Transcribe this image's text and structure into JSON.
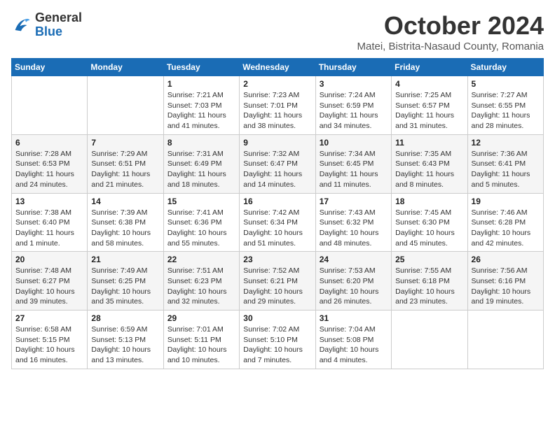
{
  "logo": {
    "general": "General",
    "blue": "Blue"
  },
  "title": "October 2024",
  "subtitle": "Matei, Bistrita-Nasaud County, Romania",
  "days": [
    "Sunday",
    "Monday",
    "Tuesday",
    "Wednesday",
    "Thursday",
    "Friday",
    "Saturday"
  ],
  "weeks": [
    [
      {
        "day": "",
        "info": ""
      },
      {
        "day": "",
        "info": ""
      },
      {
        "day": "1",
        "info": "Sunrise: 7:21 AM\nSunset: 7:03 PM\nDaylight: 11 hours and 41 minutes."
      },
      {
        "day": "2",
        "info": "Sunrise: 7:23 AM\nSunset: 7:01 PM\nDaylight: 11 hours and 38 minutes."
      },
      {
        "day": "3",
        "info": "Sunrise: 7:24 AM\nSunset: 6:59 PM\nDaylight: 11 hours and 34 minutes."
      },
      {
        "day": "4",
        "info": "Sunrise: 7:25 AM\nSunset: 6:57 PM\nDaylight: 11 hours and 31 minutes."
      },
      {
        "day": "5",
        "info": "Sunrise: 7:27 AM\nSunset: 6:55 PM\nDaylight: 11 hours and 28 minutes."
      }
    ],
    [
      {
        "day": "6",
        "info": "Sunrise: 7:28 AM\nSunset: 6:53 PM\nDaylight: 11 hours and 24 minutes."
      },
      {
        "day": "7",
        "info": "Sunrise: 7:29 AM\nSunset: 6:51 PM\nDaylight: 11 hours and 21 minutes."
      },
      {
        "day": "8",
        "info": "Sunrise: 7:31 AM\nSunset: 6:49 PM\nDaylight: 11 hours and 18 minutes."
      },
      {
        "day": "9",
        "info": "Sunrise: 7:32 AM\nSunset: 6:47 PM\nDaylight: 11 hours and 14 minutes."
      },
      {
        "day": "10",
        "info": "Sunrise: 7:34 AM\nSunset: 6:45 PM\nDaylight: 11 hours and 11 minutes."
      },
      {
        "day": "11",
        "info": "Sunrise: 7:35 AM\nSunset: 6:43 PM\nDaylight: 11 hours and 8 minutes."
      },
      {
        "day": "12",
        "info": "Sunrise: 7:36 AM\nSunset: 6:41 PM\nDaylight: 11 hours and 5 minutes."
      }
    ],
    [
      {
        "day": "13",
        "info": "Sunrise: 7:38 AM\nSunset: 6:40 PM\nDaylight: 11 hours and 1 minute."
      },
      {
        "day": "14",
        "info": "Sunrise: 7:39 AM\nSunset: 6:38 PM\nDaylight: 10 hours and 58 minutes."
      },
      {
        "day": "15",
        "info": "Sunrise: 7:41 AM\nSunset: 6:36 PM\nDaylight: 10 hours and 55 minutes."
      },
      {
        "day": "16",
        "info": "Sunrise: 7:42 AM\nSunset: 6:34 PM\nDaylight: 10 hours and 51 minutes."
      },
      {
        "day": "17",
        "info": "Sunrise: 7:43 AM\nSunset: 6:32 PM\nDaylight: 10 hours and 48 minutes."
      },
      {
        "day": "18",
        "info": "Sunrise: 7:45 AM\nSunset: 6:30 PM\nDaylight: 10 hours and 45 minutes."
      },
      {
        "day": "19",
        "info": "Sunrise: 7:46 AM\nSunset: 6:28 PM\nDaylight: 10 hours and 42 minutes."
      }
    ],
    [
      {
        "day": "20",
        "info": "Sunrise: 7:48 AM\nSunset: 6:27 PM\nDaylight: 10 hours and 39 minutes."
      },
      {
        "day": "21",
        "info": "Sunrise: 7:49 AM\nSunset: 6:25 PM\nDaylight: 10 hours and 35 minutes."
      },
      {
        "day": "22",
        "info": "Sunrise: 7:51 AM\nSunset: 6:23 PM\nDaylight: 10 hours and 32 minutes."
      },
      {
        "day": "23",
        "info": "Sunrise: 7:52 AM\nSunset: 6:21 PM\nDaylight: 10 hours and 29 minutes."
      },
      {
        "day": "24",
        "info": "Sunrise: 7:53 AM\nSunset: 6:20 PM\nDaylight: 10 hours and 26 minutes."
      },
      {
        "day": "25",
        "info": "Sunrise: 7:55 AM\nSunset: 6:18 PM\nDaylight: 10 hours and 23 minutes."
      },
      {
        "day": "26",
        "info": "Sunrise: 7:56 AM\nSunset: 6:16 PM\nDaylight: 10 hours and 19 minutes."
      }
    ],
    [
      {
        "day": "27",
        "info": "Sunrise: 6:58 AM\nSunset: 5:15 PM\nDaylight: 10 hours and 16 minutes."
      },
      {
        "day": "28",
        "info": "Sunrise: 6:59 AM\nSunset: 5:13 PM\nDaylight: 10 hours and 13 minutes."
      },
      {
        "day": "29",
        "info": "Sunrise: 7:01 AM\nSunset: 5:11 PM\nDaylight: 10 hours and 10 minutes."
      },
      {
        "day": "30",
        "info": "Sunrise: 7:02 AM\nSunset: 5:10 PM\nDaylight: 10 hours and 7 minutes."
      },
      {
        "day": "31",
        "info": "Sunrise: 7:04 AM\nSunset: 5:08 PM\nDaylight: 10 hours and 4 minutes."
      },
      {
        "day": "",
        "info": ""
      },
      {
        "day": "",
        "info": ""
      }
    ]
  ]
}
